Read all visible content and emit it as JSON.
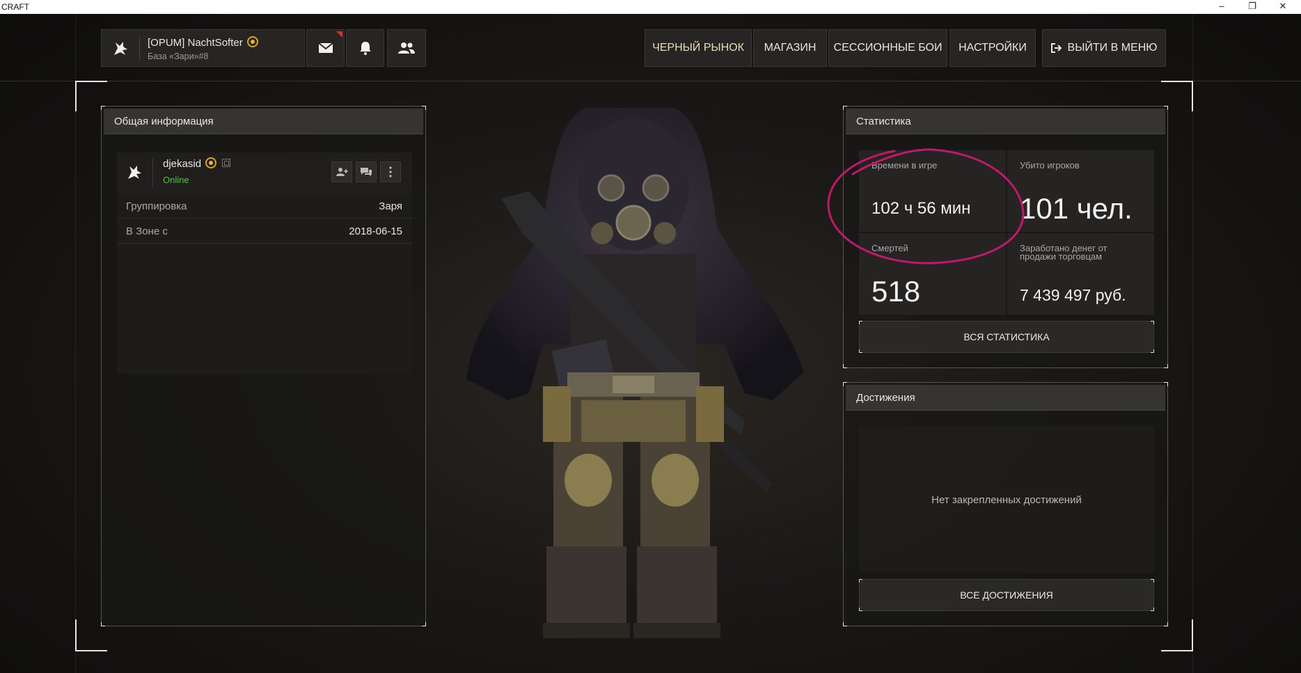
{
  "window": {
    "title": "CRAFT",
    "controls": {
      "minimize": "–",
      "maximize": "❐",
      "close": "✕"
    }
  },
  "profile": {
    "name": "[OPUM] NachtSofter",
    "base": "База «Зари»#8"
  },
  "topnav": {
    "market": "ЧЕРНЫЙ РЫНОК",
    "shop": "МАГАЗИН",
    "sessions": "СЕССИОННЫЕ БОИ",
    "settings": "НАСТРОЙКИ",
    "exit": "ВЫЙТИ В МЕНЮ"
  },
  "general": {
    "header": "Общая информация",
    "username": "djekasid",
    "status": "Online",
    "rows": [
      {
        "key": "Группировка",
        "value": "Заря"
      },
      {
        "key": "В Зоне с",
        "value": "2018-06-15"
      }
    ]
  },
  "stats": {
    "header": "Статистика",
    "cells": [
      {
        "label": "Времени в игре",
        "value": "102 ч 56 мин"
      },
      {
        "label": "Убито игроков",
        "value": "101 чел."
      },
      {
        "label": "Смертей",
        "value": "518"
      },
      {
        "label": "Заработано денег от продажи торговцам",
        "value": "7 439 497 руб."
      }
    ],
    "all_button": "ВСЯ СТАТИСТИКА"
  },
  "achievements": {
    "header": "Достижения",
    "empty": "Нет закрепленных достижений",
    "all_button": "ВСЕ ДОСТИЖЕНИЯ"
  },
  "colors": {
    "online": "#4ec93a",
    "badge": "#d8a622",
    "annotation": "#c2186b",
    "mail_flag": "#d9322b"
  },
  "icons": [
    "wolf-logo-icon",
    "mail-icon",
    "bell-icon",
    "friends-icon",
    "exit-icon",
    "add-friend-icon",
    "chat-icon",
    "more-icon",
    "copy-icon",
    "sun-badge-icon"
  ]
}
